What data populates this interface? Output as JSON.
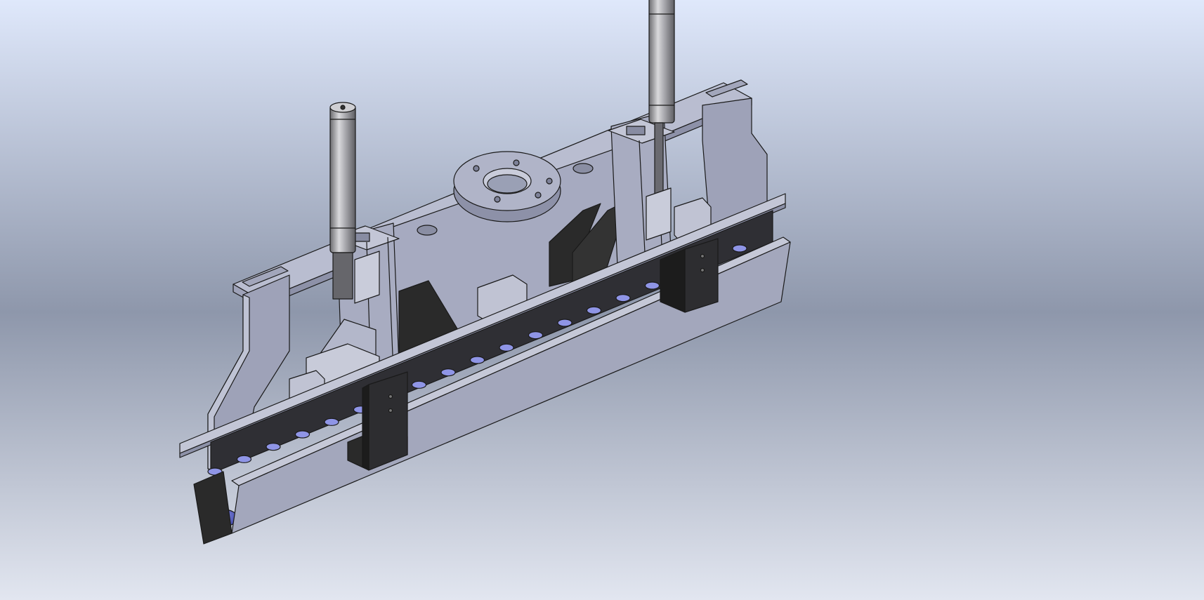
{
  "scene": {
    "kind": "cad-3d-model-viewport",
    "colors": {
      "background_top": "#dfe8fb",
      "background_mid": "#8e97ab",
      "background_bottom": "#e2e6f0",
      "steel_light": "#b9bdd0",
      "steel_mid": "#9ea2b8",
      "steel_dark": "#7d8198",
      "black_part": "#2a2a2a",
      "suction_cup": "#5c63c9",
      "suction_cup_light": "#8f95e6",
      "outline": "#1a1a1a"
    },
    "suction_cup_count": 19
  }
}
